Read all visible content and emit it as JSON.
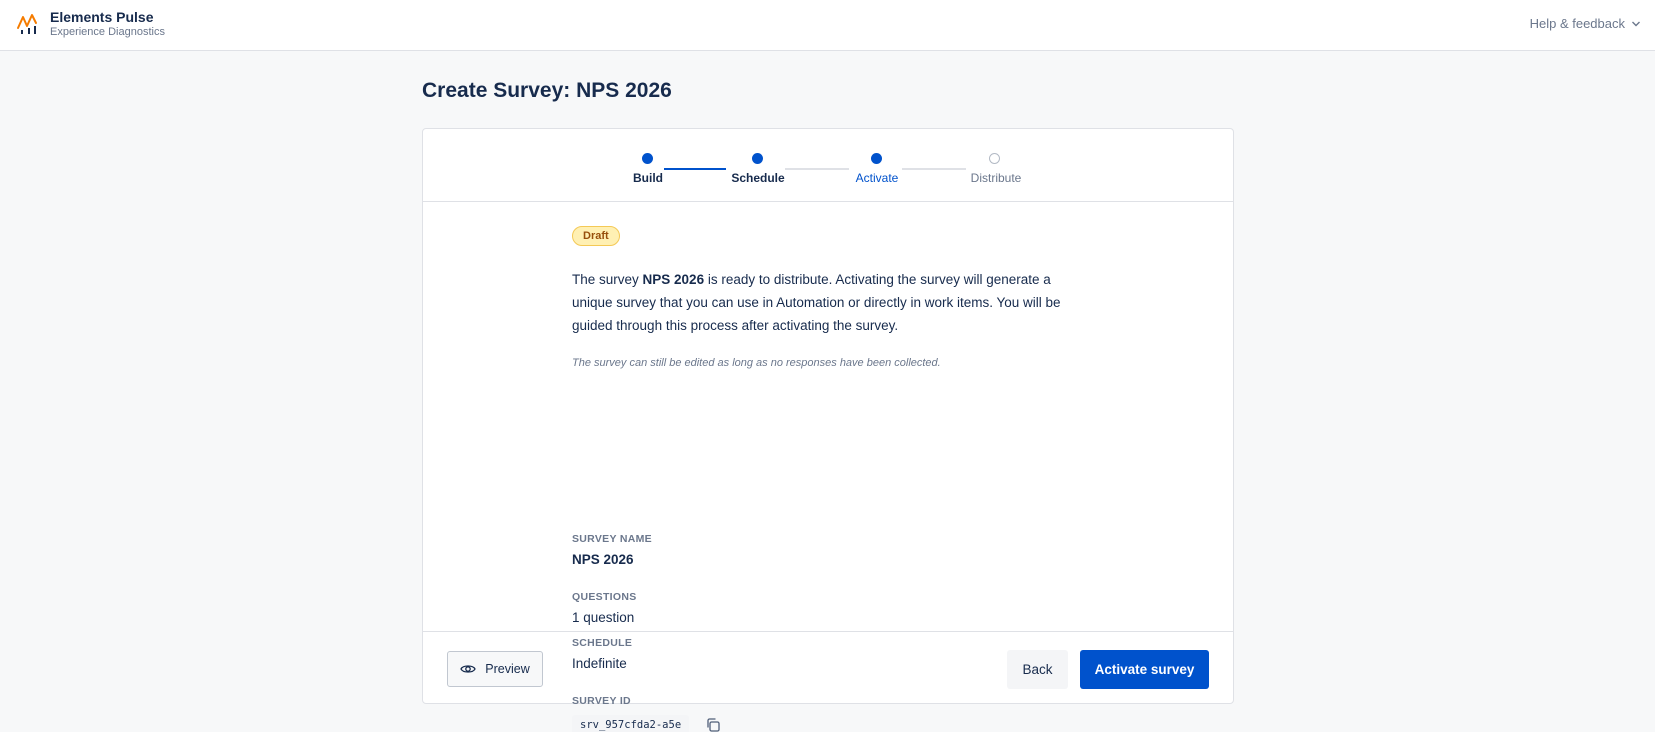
{
  "colors": {
    "primary": "#0052cc",
    "badge_bg": "#fff0b3",
    "badge_text": "#974f0c",
    "logo_orange": "#f57c00"
  },
  "header": {
    "brand_name": "Elements Pulse",
    "brand_sub": "Experience Diagnostics",
    "help_label": "Help & feedback",
    "help_icon": "chevron-down-icon"
  },
  "page": {
    "title": "Create Survey: NPS 2026"
  },
  "stepper": {
    "steps": [
      {
        "label": "Build",
        "state": "complete"
      },
      {
        "label": "Schedule",
        "state": "complete"
      },
      {
        "label": "Activate",
        "state": "active"
      },
      {
        "label": "Distribute",
        "state": "pending"
      }
    ]
  },
  "summary": {
    "status_badge": "Draft",
    "desc_prefix": "The survey ",
    "desc_name": "NPS 2026",
    "desc_suffix": " is ready to distribute. Activating the survey will generate a unique survey that you can use in Automation or directly in work items. You will be guided through this process after activating the survey.",
    "note": "The survey can still be edited as long as no responses have been collected.",
    "fields": {
      "name_label": "SURVEY NAME",
      "name_value": "NPS 2026",
      "questions_label": "QUESTIONS",
      "questions_value": "1 question",
      "schedule_label": "SCHEDULE",
      "schedule_value": "Indefinite",
      "id_label": "SURVEY ID",
      "id_value": "srv_957cfda2-a5e",
      "copy_icon": "copy-icon"
    }
  },
  "footer": {
    "preview_label": "Preview",
    "preview_icon": "eye-icon",
    "back_label": "Back",
    "activate_label": "Activate survey"
  }
}
